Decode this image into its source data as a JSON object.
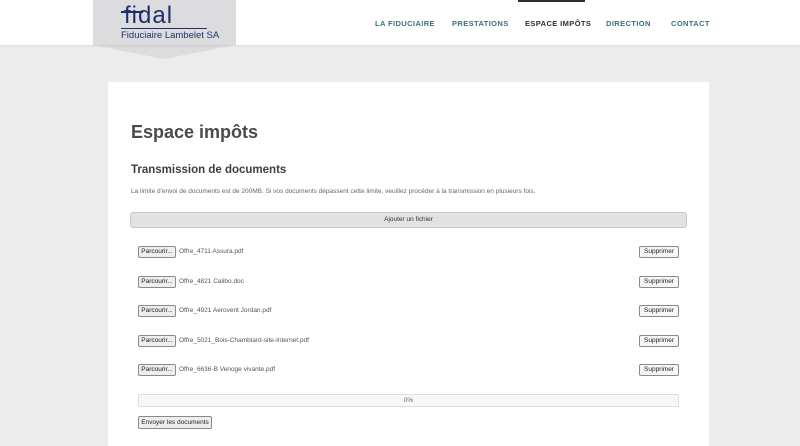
{
  "header": {
    "logo": {
      "wordmark": "fidal",
      "subtitle": "Fiduciaire Lambelet SA"
    },
    "nav": [
      {
        "label": "LA FIDUCIAIRE"
      },
      {
        "label": "PRESTATIONS"
      },
      {
        "label": "ESPACE IMPÔTS",
        "active": true
      },
      {
        "label": "DIRECTION"
      },
      {
        "label": "CONTACT"
      }
    ]
  },
  "main": {
    "title": "Espace impôts",
    "section_title": "Transmission de documents",
    "info": "La limite d'envoi de documents est de 200MB. Si vos documents dépassent cette limite, veuillez procéder à la transmission en plusieurs fois.",
    "add_file_label": "Ajouter un fichier",
    "browse_label": "Parcourir...",
    "delete_label": "Supprimer",
    "files": [
      {
        "name": "Offre_4711 Assura.pdf"
      },
      {
        "name": "Offre_4821 Calibo.doc"
      },
      {
        "name": "Offre_4921 Aerovent Jordan.pdf"
      },
      {
        "name": "Offre_5021_Bois-Chamblard-site-Internet.pdf"
      },
      {
        "name": "Offre_6636-B Venoge vivante.pdf"
      }
    ],
    "progress": {
      "value": 0,
      "label": "0%"
    },
    "send_label": "Envoyer les documents"
  },
  "colors": {
    "brand": "#1f2f6b",
    "nav_link": "#3c6e7e",
    "nav_active": "#2b2f33",
    "page_bg": "#ececec"
  }
}
